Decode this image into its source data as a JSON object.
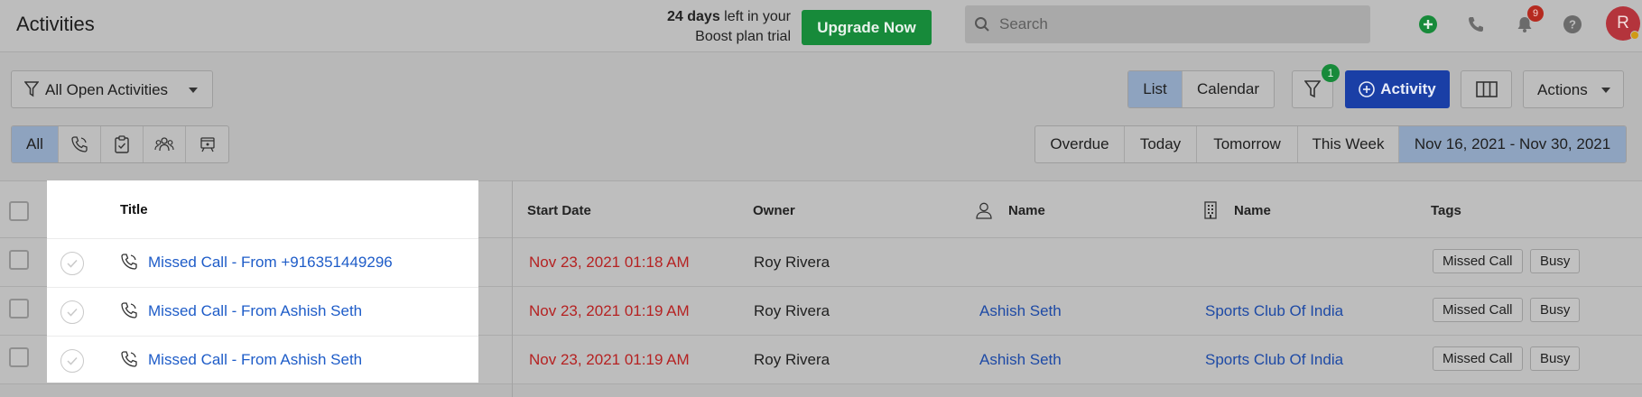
{
  "header": {
    "title": "Activities",
    "trial_days": "24 days",
    "trial_line1_rest": " left in your",
    "trial_line2": "Boost plan trial",
    "upgrade_label": "Upgrade Now",
    "search_placeholder": "Search",
    "notification_count": "9",
    "avatar_initial": "R"
  },
  "toolbar": {
    "filter_view": "All Open Activities",
    "view_tabs": [
      "List",
      "Calendar"
    ],
    "active_view": "List",
    "filter_badge_count": "1",
    "activity_button": "Activity",
    "actions_label": "Actions"
  },
  "type_tabs": {
    "all_label": "All",
    "icons": [
      "phone-icon",
      "task-clipboard-icon",
      "meeting-people-icon",
      "other-activity-icon"
    ]
  },
  "date_filters": [
    "Overdue",
    "Today",
    "Tomorrow",
    "This Week",
    "Nov 16, 2021 - Nov 30, 2021"
  ],
  "table": {
    "columns": {
      "title": "Title",
      "start_date": "Start Date",
      "owner": "Owner",
      "contact_name": "Name",
      "company_name": "Name",
      "tags": "Tags"
    },
    "rows": [
      {
        "title": "Missed Call - From +916351449296",
        "start_date": "Nov 23, 2021 01:18 AM",
        "owner": "Roy Rivera",
        "contact": "",
        "company": "",
        "tags": [
          "Missed Call",
          "Busy"
        ]
      },
      {
        "title": "Missed Call - From Ashish Seth",
        "start_date": "Nov 23, 2021 01:19 AM",
        "owner": "Roy Rivera",
        "contact": "Ashish Seth",
        "company": "Sports Club Of India",
        "tags": [
          "Missed Call",
          "Busy"
        ]
      },
      {
        "title": "Missed Call - From Ashish Seth",
        "start_date": "Nov 23, 2021 01:19 AM",
        "owner": "Roy Rivera",
        "contact": "Ashish Seth",
        "company": "Sports Club Of India",
        "tags": [
          "Missed Call",
          "Busy"
        ]
      }
    ]
  },
  "colors": {
    "upgrade_green": "#178a3a",
    "activity_blue": "#1a3fa6",
    "link_blue": "#1e5cc8",
    "date_red": "#b52222",
    "active_tab": "#8ea3bf",
    "overlay_gray": "#bdbdbd"
  }
}
